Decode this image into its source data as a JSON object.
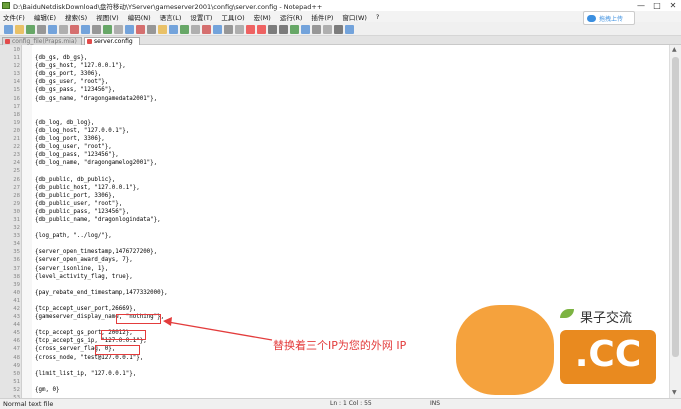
{
  "window": {
    "title": "D:\\BaiduNetdiskDownload\\盘符移动\\YServer\\gameserver2001\\config\\server.config - Notepad++",
    "controls": [
      "—",
      "□",
      "✕"
    ]
  },
  "menu": [
    "文件(F)",
    "编辑(E)",
    "搜索(S)",
    "视图(V)",
    "编码(N)",
    "语言(L)",
    "设置(T)",
    "工具(O)",
    "宏(M)",
    "运行(R)",
    "插件(P)",
    "窗口(W)",
    "?"
  ],
  "upload_button": {
    "label": "拖拽上传"
  },
  "tabs": [
    {
      "label": "config_file(Praps.mia)"
    },
    {
      "label": "server.config"
    }
  ],
  "editor": {
    "lines": [
      {
        "n": "10",
        "text": ""
      },
      {
        "n": "11",
        "text": "{db_gs, db_gs},"
      },
      {
        "n": "12",
        "text": "{db_gs_host, \"127.0.0.1\"},"
      },
      {
        "n": "13",
        "text": "{db_gs_port, 3306},"
      },
      {
        "n": "14",
        "text": "{db_gs_user, \"root\"},"
      },
      {
        "n": "15",
        "text": "{db_gs_pass, \"123456\"},"
      },
      {
        "n": "16",
        "text": "{db_gs_name, \"dragongamedata2001\"},"
      },
      {
        "n": "17",
        "text": ""
      },
      {
        "n": "18",
        "text": ""
      },
      {
        "n": "19",
        "text": "{db_log, db_log},"
      },
      {
        "n": "20",
        "text": "{db_log_host, \"127.0.0.1\"},"
      },
      {
        "n": "21",
        "text": "{db_log_port, 3306},"
      },
      {
        "n": "22",
        "text": "{db_log_user, \"root\"},"
      },
      {
        "n": "23",
        "text": "{db_log_pass, \"123456\"},"
      },
      {
        "n": "24",
        "text": "{db_log_name, \"dragongamelog2001\"},"
      },
      {
        "n": "25",
        "text": ""
      },
      {
        "n": "26",
        "text": "{db_public, db_public},"
      },
      {
        "n": "27",
        "text": "{db_public_host, \"127.0.0.1\"},"
      },
      {
        "n": "28",
        "text": "{db_public_port, 3306},"
      },
      {
        "n": "29",
        "text": "{db_public_user, \"root\"},"
      },
      {
        "n": "30",
        "text": "{db_public_pass, \"123456\"},"
      },
      {
        "n": "31",
        "text": "{db_public_name, \"dragonlogindata\"},"
      },
      {
        "n": "32",
        "text": ""
      },
      {
        "n": "33",
        "text": "{log_path, \"../log/\"},"
      },
      {
        "n": "34",
        "text": ""
      },
      {
        "n": "35",
        "text": "{server_open_timestamp,1476727200},"
      },
      {
        "n": "36",
        "text": "{server_open_award_days, 7},"
      },
      {
        "n": "37",
        "text": "{server_isonline, 1},"
      },
      {
        "n": "38",
        "text": "{level_activity_flag, true},"
      },
      {
        "n": "39",
        "text": ""
      },
      {
        "n": "40",
        "text": "{pay_rebate_end_timestamp,1477332000},"
      },
      {
        "n": "41",
        "text": ""
      },
      {
        "n": "42",
        "text": "{tcp_accept_user_port,26669},"
      },
      {
        "n": "43",
        "text": "{gameserver_display_name, \"nothing\"},"
      },
      {
        "n": "44",
        "text": ""
      },
      {
        "n": "45",
        "text": "{tcp_accept_gs_port, 20012},"
      },
      {
        "n": "46",
        "text": "{tcp_accept_gs_ip, \"127.0.0.1\"},"
      },
      {
        "n": "47",
        "text": "{cross_server_flag, 0},"
      },
      {
        "n": "48",
        "text": "{cross_node, \"test@127.0.0.1\"},"
      },
      {
        "n": "49",
        "text": ""
      },
      {
        "n": "50",
        "text": "{limit_list_ip, \"127.0.0.1\"},"
      },
      {
        "n": "51",
        "text": ""
      },
      {
        "n": "52",
        "text": "{gm, 0}"
      },
      {
        "n": "53",
        "text": ""
      },
      {
        "n": "54",
        "text": "]."
      },
      {
        "n": "55",
        "text": ""
      }
    ]
  },
  "annotation": {
    "text": "替换着三个IP为您的外网 IP"
  },
  "watermark": {
    "brand": "果子交流",
    "domain": ".CC"
  },
  "status": {
    "file_type": "Normal text file",
    "position": "Ln : 1   Col : 55",
    "mode": "INS"
  },
  "colors": {
    "annotation_red": "#e33c3c",
    "watermark_orange": "#f49a2c",
    "upload_blue": "#3b8fe0"
  }
}
